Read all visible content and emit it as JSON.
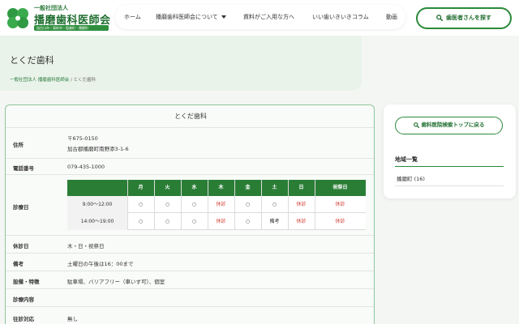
{
  "header": {
    "logo": {
      "small_text": "一般社団法人",
      "name": "播磨歯科医師会",
      "sub_text": "加古川市・高砂市・稲美町・播磨町"
    },
    "nav": [
      {
        "label": "ホーム"
      },
      {
        "label": "播磨歯科医師会について"
      },
      {
        "label": "資料がご入用な方へ"
      },
      {
        "label": "いい歯いきいきコラム"
      },
      {
        "label": "動画"
      }
    ],
    "search_button": "歯医者さんを探す"
  },
  "page": {
    "title": "とくだ歯科",
    "breadcrumb": [
      "一般社団法人 播磨歯科医師会",
      "/",
      "とくだ歯科"
    ]
  },
  "clinic": {
    "name": "とくだ歯科",
    "address_label": "住所",
    "postal": "〒675-0150",
    "address": "加古郡播磨町南野添3-1-6",
    "phone_label": "電話番号",
    "phone": "079-435-1000",
    "hours_label": "診療日",
    "schedule": {
      "days": [
        "月",
        "火",
        "水",
        "木",
        "金",
        "土",
        "日",
        "祝祭日"
      ],
      "rows": [
        {
          "time": "9:00～12:00",
          "cells": [
            "○",
            "○",
            "○",
            "休診",
            "○",
            "○",
            "休診",
            "休診"
          ]
        },
        {
          "time": "14:00～19:00",
          "cells": [
            "○",
            "○",
            "○",
            "休診",
            "○",
            "備考",
            "休診",
            "休診"
          ]
        }
      ]
    },
    "closed_label": "休診日",
    "closed_days": "木・日・祝祭日",
    "notes_label": "備考",
    "notes": "土曜日の午後は16：00まで",
    "facilities_label": "設備・特徴",
    "facilities": "駐車場、バリアフリー（車いす可）、個室",
    "treatment_label": "診療内容",
    "treatment": "",
    "home_visit_label": "往診対応",
    "home_visit": "無し"
  },
  "sidebar": {
    "back_button": "歯科医院検索トップに戻る",
    "region_title": "地域一覧",
    "regions": [
      {
        "label": "播磨町 (16)"
      }
    ]
  },
  "colors": {
    "brand_green": "#2a7d35",
    "closed_red": "#d13b2e"
  }
}
